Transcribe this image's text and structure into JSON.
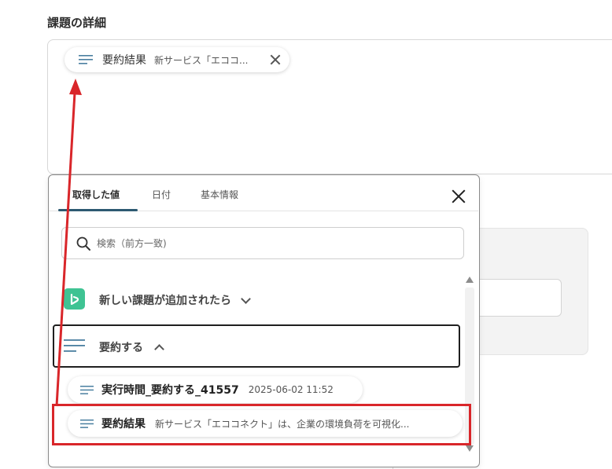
{
  "section": {
    "title": "課題の詳細"
  },
  "selected_chip": {
    "label": "要約結果",
    "value": "新サービス「エココ..."
  },
  "popup": {
    "tabs": [
      "取得した値",
      "日付",
      "基本情報"
    ],
    "active_tab": 0,
    "search_placeholder": "検索（前方一致)",
    "trigger": {
      "label": "新しい課題が追加されたら"
    },
    "group": {
      "label": "要約する"
    },
    "values": [
      {
        "label": "実行時間_要約する_41557",
        "value": "2025-06-02 11:52"
      },
      {
        "label": "要約結果",
        "value": "新サービス「エココネクト」は、企業の環境負荷を可視化..."
      }
    ]
  },
  "colors": {
    "annotation": "#d9262a",
    "app_accent": "#3fc393",
    "tab_underline": "#2d5a72"
  },
  "icons": {
    "chip": "lines-icon",
    "search": "search-icon",
    "app": "backlog-app-icon"
  }
}
